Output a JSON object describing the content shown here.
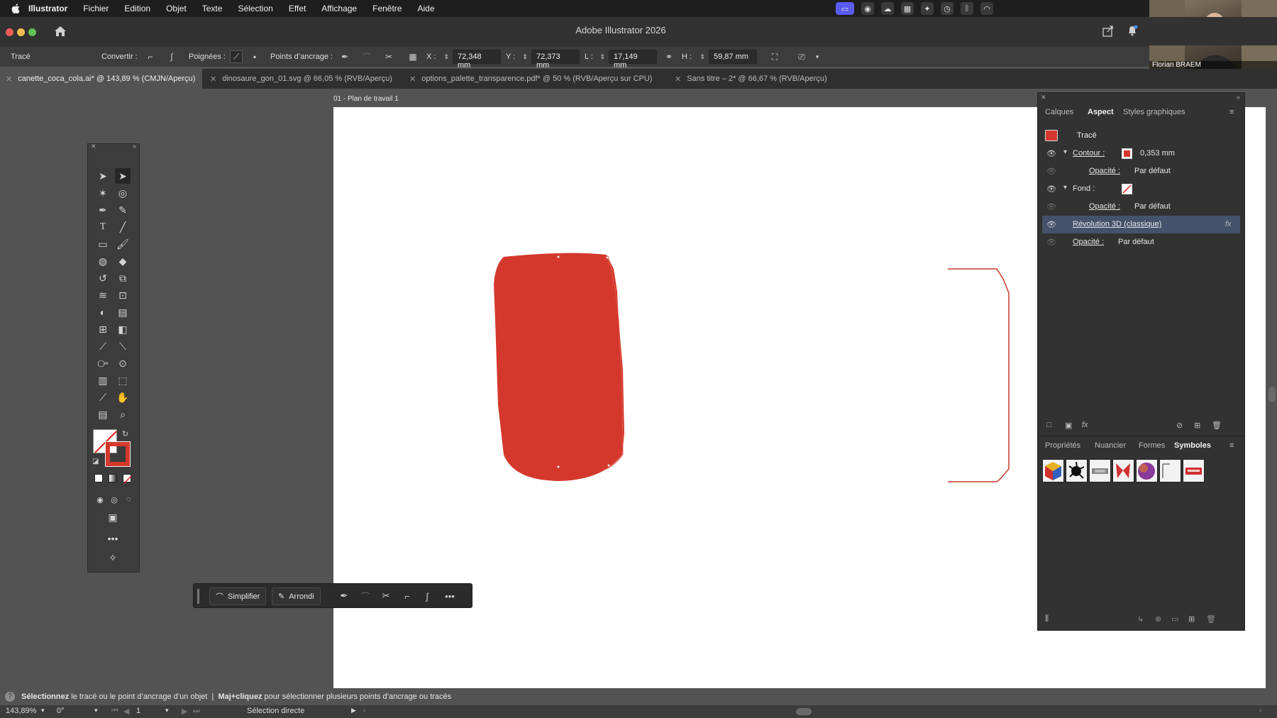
{
  "menubar": {
    "items": [
      "Illustrator",
      "Fichier",
      "Edition",
      "Objet",
      "Texte",
      "Sélection",
      "Effet",
      "Affichage",
      "Fenêtre",
      "Aide"
    ]
  },
  "window": {
    "title": "Adobe Illustrator 2026"
  },
  "controlbar": {
    "object_type": "Tracé",
    "convert_label": "Convertir :",
    "handles_label": "Poignées :",
    "anchors_label": "Points d’ancrage :",
    "x_label": "X :",
    "x_value": "72,348 mm",
    "y_label": "Y :",
    "y_value": "72,373 mm",
    "w_label": "L :",
    "w_value": "17,149 mm",
    "h_label": "H :",
    "h_value": "59,87 mm"
  },
  "tabs": [
    {
      "label": "canette_coca_cola.ai* @ 143,89 % (CMJN/Aperçu)"
    },
    {
      "label": "dinosaure_gon_01.svg @ 66,05 % (RVB/Aperçu)"
    },
    {
      "label": "options_palette_transparence.pdf* @ 50 % (RVB/Aperçu sur CPU)"
    },
    {
      "label": "Sans titre – 2* @ 66,67 % (RVB/Aperçu)"
    }
  ],
  "artboard": {
    "label": "01 - Plan de travail 1"
  },
  "context_bar": {
    "simplify": "Simplifier",
    "round": "Arrondi"
  },
  "appearance_panel": {
    "tabs": [
      "Calques",
      "Aspect",
      "Styles graphiques"
    ],
    "header": "Tracé",
    "rows": [
      {
        "label": "Contour :",
        "value": "0,353 mm"
      },
      {
        "label": "Opacité :",
        "value": "Par défaut"
      },
      {
        "label": "Fond :",
        "value": ""
      },
      {
        "label": "Opacité :",
        "value": "Par défaut"
      },
      {
        "label": "Révolution 3D (classique)",
        "value": ""
      },
      {
        "label": "Opacité :",
        "value": "Par défaut"
      }
    ],
    "fx": "fx"
  },
  "lower_panel": {
    "tabs": [
      "Propriétés",
      "Nuancier",
      "Formes",
      "Symboles"
    ]
  },
  "hint": {
    "part1_bold": "Sélectionnez",
    "part2": " le tracé ou le point d’ancrage d’un objet",
    "sep": "|",
    "part3_bold": "Maj+cliquez",
    "part4": " pour sélectionner plusieurs points d’ancrage ou tracés"
  },
  "statusbar": {
    "zoom": "143,89%",
    "rotation": "0°",
    "artboard_num": "1",
    "tool": "Sélection directe"
  },
  "webcam": {
    "name": "Florian BRAEM"
  },
  "colors": {
    "can_red": "#d4382c",
    "accent": "#5b5bf0"
  }
}
